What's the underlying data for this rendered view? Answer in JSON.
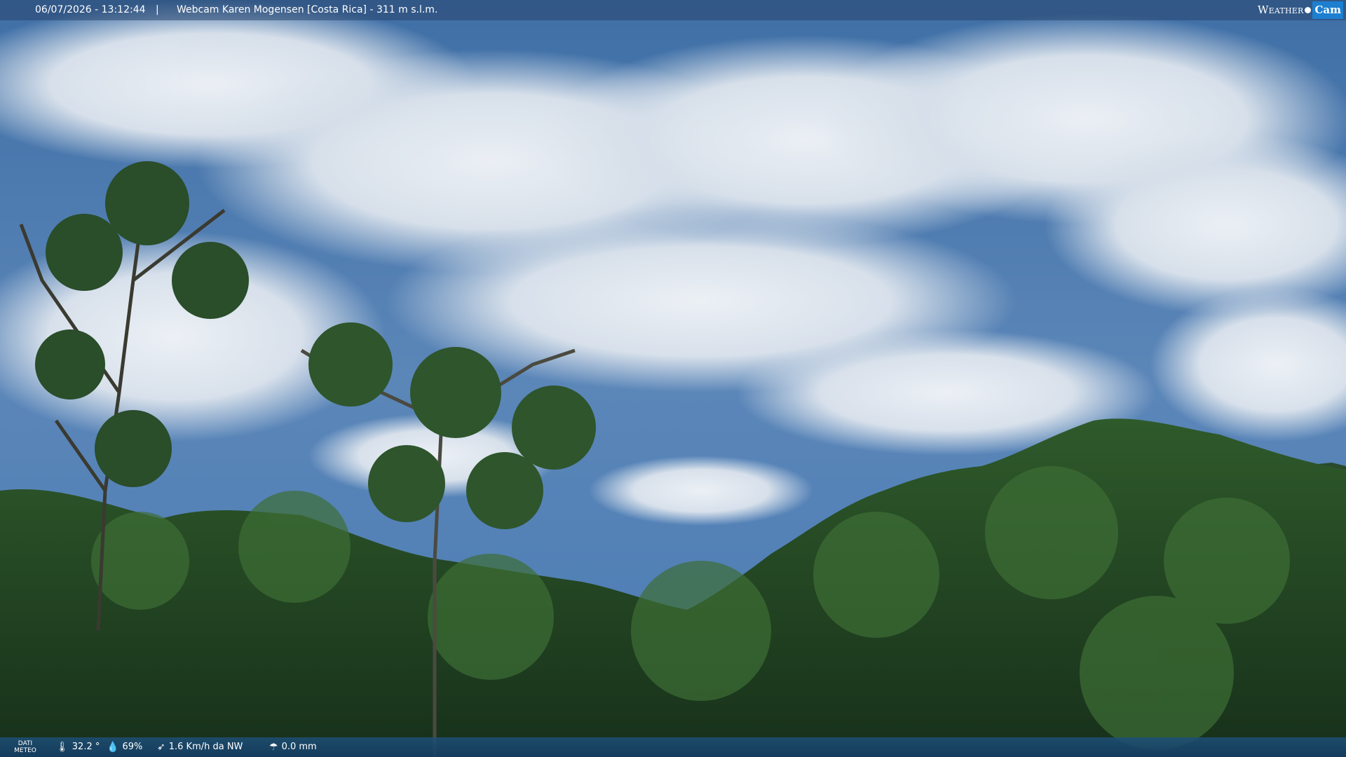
{
  "header": {
    "datetime": "06/07/2026 - 13:12:44",
    "separator": "|",
    "title": "Webcam Karen Mogensen [Costa Rica] - 311 m s.l.m."
  },
  "logo": {
    "weather": "Weather",
    "cam": "Cam"
  },
  "footer": {
    "dati_meteo": "DATI METEO",
    "temperature": "32.2 °",
    "humidity": "69%",
    "wind": "1.6 Km/h da NW",
    "rain": "0.0 mm"
  },
  "colors": {
    "sky": "#3a6aa0",
    "cloud": "#e8edf3",
    "forest_dark": "#1f3a1f",
    "forest_mid": "#2e5a2a",
    "logo_accent": "#1d7fd0"
  }
}
